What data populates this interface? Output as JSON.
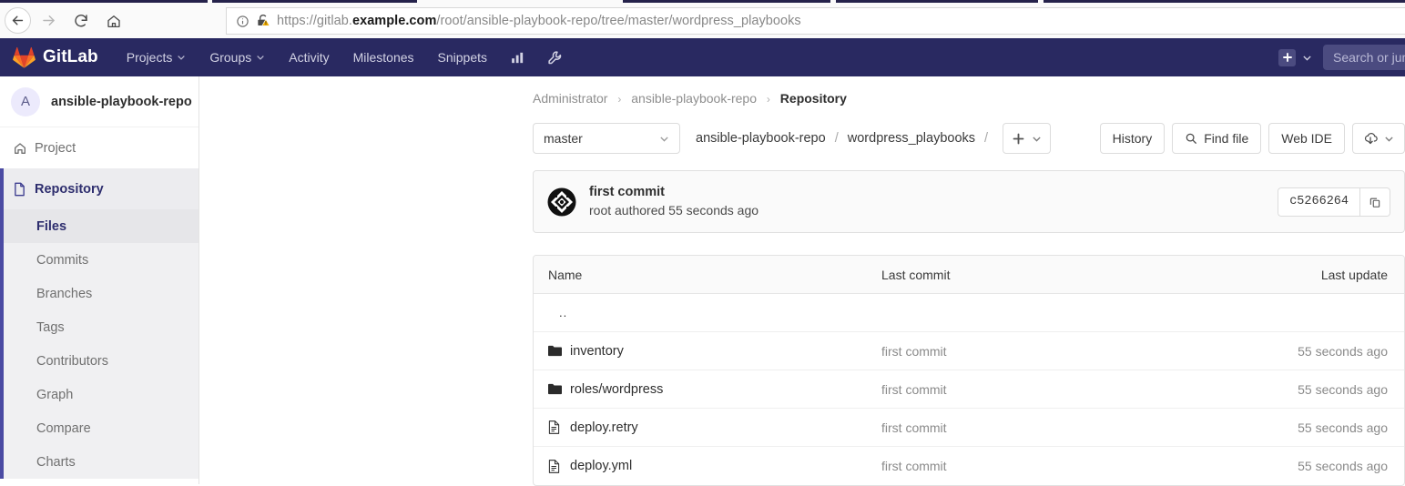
{
  "browser": {
    "back_icon": "arrow-left-icon",
    "forward_icon": "arrow-right-icon",
    "reload_icon": "reload-icon",
    "home_icon": "home-icon",
    "info_icon": "info-circle-icon",
    "security_icon": "insecure-lock-warning-icon",
    "url_prefix": "https://gitlab.",
    "url_domain": "example.com",
    "url_path": "/root/ansible-playbook-repo/tree/master/wordpress_playbooks"
  },
  "navbar": {
    "brand": "GitLab",
    "brand_icon": "gitlab-tanuki-icon",
    "items": [
      {
        "label": "Projects",
        "caret": true
      },
      {
        "label": "Groups",
        "caret": true
      },
      {
        "label": "Activity",
        "caret": false
      },
      {
        "label": "Milestones",
        "caret": false
      },
      {
        "label": "Snippets",
        "caret": false
      }
    ],
    "icons": [
      {
        "name": "chart-icon"
      },
      {
        "name": "wrench-icon"
      }
    ],
    "plus_icon": "plus-square-icon",
    "plus_caret_icon": "chevron-down-icon",
    "search_placeholder": "Search or jum"
  },
  "sidebar": {
    "avatar_letter": "A",
    "project_name": "ansible-playbook-repo",
    "items": [
      {
        "label": "Project",
        "icon": "home-icon",
        "active": false
      },
      {
        "label": "Repository",
        "icon": "document-icon",
        "active": true
      }
    ],
    "sub_items": [
      {
        "label": "Files",
        "active": true
      },
      {
        "label": "Commits",
        "active": false
      },
      {
        "label": "Branches",
        "active": false
      },
      {
        "label": "Tags",
        "active": false
      },
      {
        "label": "Contributors",
        "active": false
      },
      {
        "label": "Graph",
        "active": false
      },
      {
        "label": "Compare",
        "active": false
      },
      {
        "label": "Charts",
        "active": false
      }
    ]
  },
  "breadcrumb": {
    "owner": "Administrator",
    "project": "ansible-playbook-repo",
    "current": "Repository"
  },
  "toolbar": {
    "branch": "master",
    "branch_caret_icon": "chevron-down-icon",
    "path_root": "ansible-playbook-repo",
    "path_dir": "wordpress_playbooks",
    "add_icon": "plus-icon",
    "add_caret_icon": "chevron-down-icon",
    "history_label": "History",
    "find_file_label": "Find file",
    "find_file_icon": "search-icon",
    "web_ide_label": "Web IDE",
    "download_icon": "cloud-download-icon",
    "download_caret_icon": "chevron-down-icon"
  },
  "commit": {
    "avatar_icon": "identicon-avatar",
    "message": "first commit",
    "meta": "root authored 55 seconds ago",
    "sha": "c5266264",
    "copy_icon": "copy-icon"
  },
  "file_table": {
    "columns": {
      "name": "Name",
      "last_commit": "Last commit",
      "last_update": "Last update"
    },
    "parent_row": "..",
    "rows": [
      {
        "name": "inventory",
        "type": "folder",
        "icon": "folder-icon",
        "last_commit": "first commit",
        "last_update": "55 seconds ago"
      },
      {
        "name": "roles/wordpress",
        "type": "folder",
        "icon": "folder-icon",
        "last_commit": "first commit",
        "last_update": "55 seconds ago"
      },
      {
        "name": "deploy.retry",
        "type": "file",
        "icon": "file-icon",
        "last_commit": "first commit",
        "last_update": "55 seconds ago"
      },
      {
        "name": "deploy.yml",
        "type": "file",
        "icon": "file-icon",
        "last_commit": "first commit",
        "last_update": "55 seconds ago"
      }
    ]
  },
  "colors": {
    "navbar": "#292961",
    "accent": "#4b4ba3",
    "tanuki_orange": "#e24329",
    "warning": "#f0ad00"
  }
}
